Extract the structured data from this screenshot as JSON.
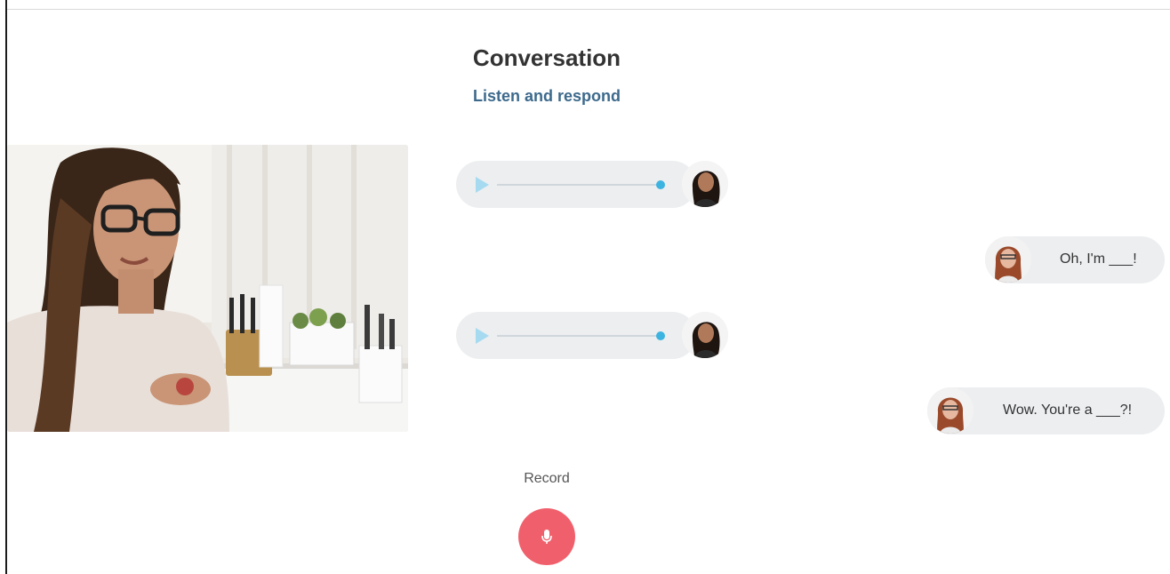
{
  "header": {
    "title": "Conversation",
    "subtitle": "Listen and respond"
  },
  "video": {
    "icon": "video-scene"
  },
  "messages": [
    {
      "type": "audio",
      "speaker_avatar": "woman-dark-hair-avatar-icon"
    },
    {
      "type": "text",
      "text": "Oh, I'm ___!",
      "speaker_avatar": "woman-red-hair-avatar-icon"
    },
    {
      "type": "audio",
      "speaker_avatar": "woman-dark-hair-avatar-icon"
    },
    {
      "type": "text",
      "text": "Wow. You're a ___?!",
      "speaker_avatar": "woman-red-hair-avatar-icon"
    }
  ],
  "record": {
    "label": "Record",
    "icon": "microphone-icon"
  },
  "colors": {
    "title": "#333333",
    "subtitle": "#3d6a8c",
    "bubble_bg": "#eceef0",
    "play_icon": "#a6daf0",
    "progress_knob": "#3cb3e0",
    "record_button": "#f0606c"
  }
}
